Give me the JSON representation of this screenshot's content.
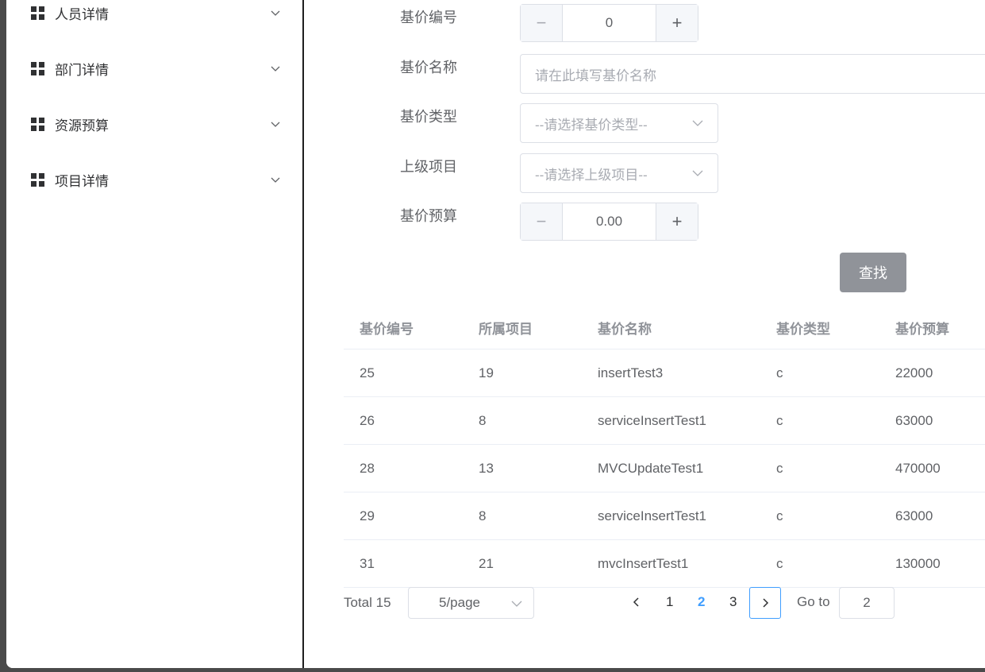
{
  "sidebar": {
    "items": [
      {
        "label": "人员详情",
        "icon": "grid-icon"
      },
      {
        "label": "部门详情",
        "icon": "grid-icon"
      },
      {
        "label": "资源预算",
        "icon": "grid-icon"
      },
      {
        "label": "项目详情",
        "icon": "grid-icon"
      }
    ]
  },
  "form": {
    "id_label": "基价编号",
    "id_value": "0",
    "name_label": "基价名称",
    "name_placeholder": "请在此填写基价名称",
    "type_label": "基价类型",
    "type_placeholder": "--请选择基价类型--",
    "parent_label": "上级项目",
    "parent_placeholder": "--请选择上级项目--",
    "budget_label": "基价预算",
    "budget_value": "0.00",
    "minus_symbol": "−",
    "plus_symbol": "+",
    "search_label": "查找"
  },
  "table": {
    "headers": [
      "基价编号",
      "所属项目",
      "基价名称",
      "基价类型",
      "基价预算"
    ],
    "rows": [
      [
        "25",
        "19",
        "insertTest3",
        "c",
        "22000"
      ],
      [
        "26",
        "8",
        "serviceInsertTest1",
        "c",
        "63000"
      ],
      [
        "28",
        "13",
        "MVCUpdateTest1",
        "c",
        "470000"
      ],
      [
        "29",
        "8",
        "serviceInsertTest1",
        "c",
        "63000"
      ],
      [
        "31",
        "21",
        "mvcInsertTest1",
        "c",
        "130000"
      ]
    ]
  },
  "pagination": {
    "total": "Total 15",
    "page_size": "5/page",
    "pages": [
      "1",
      "2",
      "3"
    ],
    "current_page": "2",
    "goto_label": "Go to",
    "goto_value": "2"
  },
  "colors": {
    "accent": "#409eff",
    "search_button": "#909399",
    "border": "#dcdfe6"
  }
}
